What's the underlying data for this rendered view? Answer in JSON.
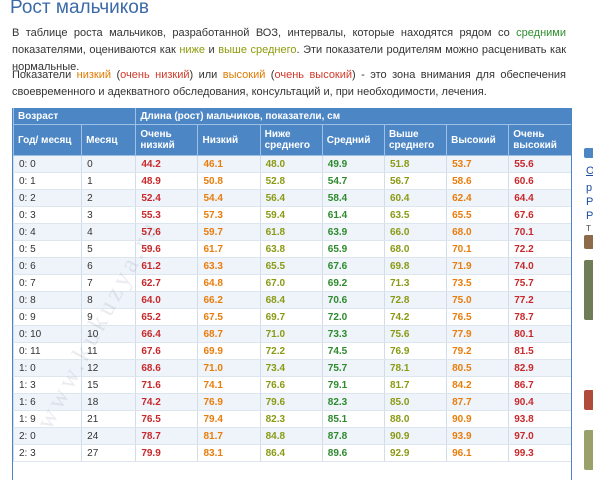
{
  "title": "Рост мальчиков",
  "intro": {
    "p1_a": "В таблице роста мальчиков, разработанной ВОЗ, интервалы, которые находятся рядом со ",
    "p1_srednimi": "средними",
    "p1_b": " показателями, оцениваются как ",
    "p1_nizhe": "ниже",
    "p1_i": " и ",
    "p1_vyshe": "выше среднего",
    "p1_c": ". Эти показатели родителям можно расценивать как нормальные.",
    "p2_a": "Показатели ",
    "p2_nizkiy": "низкий",
    "p2_open1": " (",
    "p2_ochen_nizkiy": "очень низкий",
    "p2_mid": ") или ",
    "p2_vysokiy": "высокий",
    "p2_open2": " (",
    "p2_ochen_vysokiy": "очень высокий",
    "p2_b": ") - это зона внимания для обеспечения своевременного и адекватного обследования, консультаций и, при необходимости, лечения."
  },
  "table": {
    "group_age": "Возраст",
    "group_length": "Длина (рост) мальчиков, показатели, см",
    "columns": [
      "Год/ месяц",
      "Месяц",
      "Очень низкий",
      "Низкий",
      "Ниже среднего",
      "Средний",
      "Выше среднего",
      "Высокий",
      "Очень высокий"
    ],
    "rows": [
      [
        "0: 0",
        "0",
        "44.2",
        "46.1",
        "48.0",
        "49.9",
        "51.8",
        "53.7",
        "55.6"
      ],
      [
        "0: 1",
        "1",
        "48.9",
        "50.8",
        "52.8",
        "54.7",
        "56.7",
        "58.6",
        "60.6"
      ],
      [
        "0: 2",
        "2",
        "52.4",
        "54.4",
        "56.4",
        "58.4",
        "60.4",
        "62.4",
        "64.4"
      ],
      [
        "0: 3",
        "3",
        "55.3",
        "57.3",
        "59.4",
        "61.4",
        "63.5",
        "65.5",
        "67.6"
      ],
      [
        "0: 4",
        "4",
        "57.6",
        "59.7",
        "61.8",
        "63.9",
        "66.0",
        "68.0",
        "70.1"
      ],
      [
        "0: 5",
        "5",
        "59.6",
        "61.7",
        "63.8",
        "65.9",
        "68.0",
        "70.1",
        "72.2"
      ],
      [
        "0: 6",
        "6",
        "61.2",
        "63.3",
        "65.5",
        "67.6",
        "69.8",
        "71.9",
        "74.0"
      ],
      [
        "0: 7",
        "7",
        "62.7",
        "64.8",
        "67.0",
        "69.2",
        "71.3",
        "73.5",
        "75.7"
      ],
      [
        "0: 8",
        "8",
        "64.0",
        "66.2",
        "68.4",
        "70.6",
        "72.8",
        "75.0",
        "77.2"
      ],
      [
        "0: 9",
        "9",
        "65.2",
        "67.5",
        "69.7",
        "72.0",
        "74.2",
        "76.5",
        "78.7"
      ],
      [
        "0: 10",
        "10",
        "66.4",
        "68.7",
        "71.0",
        "73.3",
        "75.6",
        "77.9",
        "80.1"
      ],
      [
        "0: 11",
        "11",
        "67.6",
        "69.9",
        "72.2",
        "74.5",
        "76.9",
        "79.2",
        "81.5"
      ],
      [
        "1: 0",
        "12",
        "68.6",
        "71.0",
        "73.4",
        "75.7",
        "78.1",
        "80.5",
        "82.9"
      ],
      [
        "1: 3",
        "15",
        "71.6",
        "74.1",
        "76.6",
        "79.1",
        "81.7",
        "84.2",
        "86.7"
      ],
      [
        "1: 6",
        "18",
        "74.2",
        "76.9",
        "79.6",
        "82.3",
        "85.0",
        "87.7",
        "90.4"
      ],
      [
        "1: 9",
        "21",
        "76.5",
        "79.4",
        "82.3",
        "85.1",
        "88.0",
        "90.9",
        "93.8"
      ],
      [
        "2: 0",
        "24",
        "78.7",
        "81.7",
        "84.8",
        "87.8",
        "90.9",
        "93.9",
        "97.0"
      ],
      [
        "2: 3",
        "27",
        "79.9",
        "83.1",
        "86.4",
        "89.6",
        "92.9",
        "96.1",
        "99.3"
      ]
    ]
  },
  "watermark": "www.kukuzya.ru",
  "side": {
    "snippet1": "О",
    "snippet2": "р",
    "snippet3": "Р",
    "snippet4": "Р",
    "snippet5": "т"
  },
  "colors": {
    "header_bg": "#4c86c5",
    "title": "#3c6aa8",
    "very_low": "#c8282a",
    "low": "#e87d0c",
    "near_avg": "#8a9a14",
    "average": "#2c8a2c"
  }
}
